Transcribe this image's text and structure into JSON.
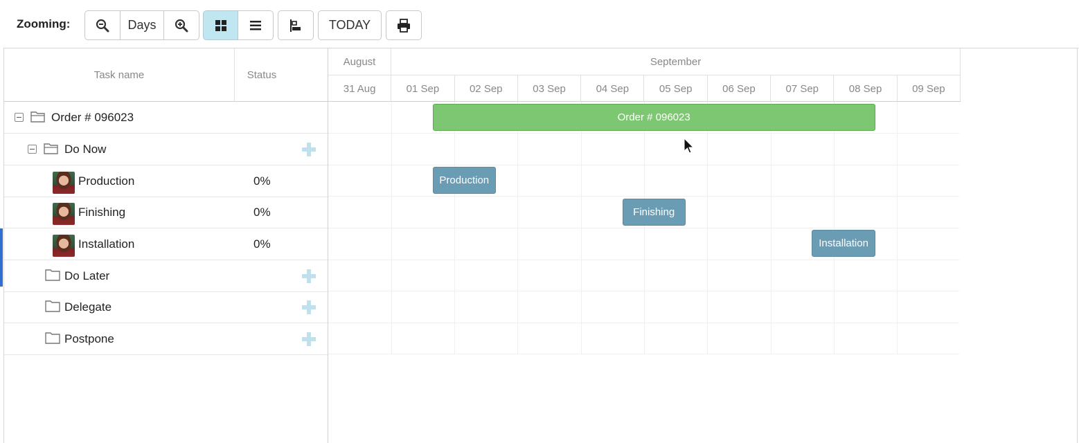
{
  "toolbar": {
    "zoom_label": "Zooming:",
    "zoom_level": "Days",
    "today_label": "TODAY",
    "icons": [
      "zoom-out-icon",
      "zoom-in-icon",
      "grid-view-icon",
      "list-view-icon",
      "baseline-icon",
      "print-icon"
    ]
  },
  "grid": {
    "columns": {
      "task_name": "Task name",
      "status": "Status"
    },
    "rows": [
      {
        "name": "Order # 096023",
        "status": "",
        "kind": "project",
        "level": 0,
        "expanded": true
      },
      {
        "name": "Do Now",
        "status": "",
        "kind": "group",
        "level": 1,
        "expanded": true
      },
      {
        "name": "Production",
        "status": "0%",
        "kind": "task",
        "level": 2
      },
      {
        "name": "Finishing",
        "status": "0%",
        "kind": "task",
        "level": 2
      },
      {
        "name": "Installation",
        "status": "0%",
        "kind": "task",
        "level": 2
      },
      {
        "name": "Do Later",
        "status": "",
        "kind": "group",
        "level": 1,
        "expanded": false
      },
      {
        "name": "Delegate",
        "status": "",
        "kind": "group",
        "level": 1,
        "expanded": false
      },
      {
        "name": "Postpone",
        "status": "",
        "kind": "group",
        "level": 1,
        "expanded": false
      }
    ]
  },
  "timeline": {
    "months": [
      "August",
      "September"
    ],
    "days": [
      "31 Aug",
      "01 Sep",
      "02 Sep",
      "03 Sep",
      "04 Sep",
      "05 Sep",
      "06 Sep",
      "07 Sep",
      "08 Sep",
      "09 Sep"
    ],
    "bars": [
      {
        "label": "Order # 096023",
        "row": 0,
        "type": "project",
        "start_day": 1.65,
        "end_day": 8.65
      },
      {
        "label": "Production",
        "row": 2,
        "type": "task",
        "start_day": 1.65,
        "end_day": 2.65
      },
      {
        "label": "Finishing",
        "row": 3,
        "type": "task",
        "start_day": 4.65,
        "end_day": 5.65
      },
      {
        "label": "Installation",
        "row": 4,
        "type": "task",
        "start_day": 7.65,
        "end_day": 8.65
      }
    ]
  },
  "colors": {
    "project_bar": "#7ec772",
    "task_bar": "#6a9db3",
    "active_button": "#bfe6f1",
    "plus_icon": "#bfe1ee"
  }
}
